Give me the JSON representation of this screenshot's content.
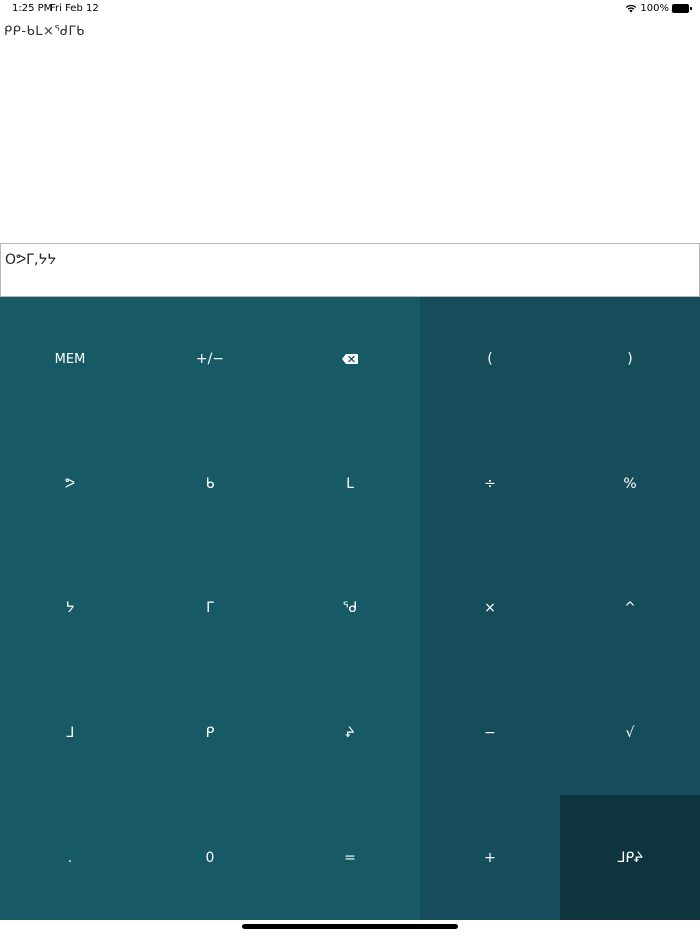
{
  "status_bar": {
    "time": "1:25 PM",
    "date": "Fri Feb 12",
    "battery": "100%"
  },
  "expression": "ᑭᑭ-ᑲᒪ×ᖁᒥᑲ",
  "result": "Oᕗᒥ,ᔭᔭ",
  "keys": {
    "mem": "MEM",
    "plus_minus": "+/−",
    "open_paren": "(",
    "close_paren": ")",
    "n9": "ᕗ",
    "n8": "ᑲ",
    "n7": "ᒪ",
    "divide": "÷",
    "percent": "%",
    "n6": "ᔭ",
    "n5": "ᒥ",
    "n4": "ᖁ",
    "multiply": "×",
    "power": "^",
    "n3": "ᒧ",
    "n2": "ᑭ",
    "n1": "ᖨ",
    "minus": "−",
    "sqrt": "√",
    "decimal": ".",
    "n0": "0",
    "equals": "=",
    "plus": "+",
    "memory_value": "ᒧᑭᖨ"
  },
  "colors": {
    "number_key": "#185966",
    "operator_key": "#154e5a",
    "memory_key": "#0e353e",
    "key_text": "#ffffff"
  },
  "icons": {
    "backspace": "backspace-icon",
    "wifi": "wifi-icon",
    "battery": "battery-icon"
  }
}
